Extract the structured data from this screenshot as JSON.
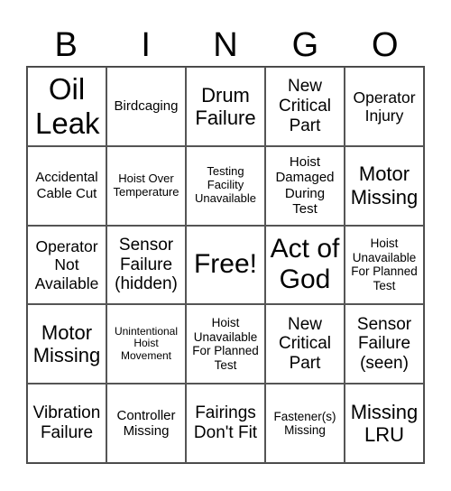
{
  "header": [
    "B",
    "I",
    "N",
    "G",
    "O"
  ],
  "cells": [
    [
      "Oil Leak",
      "Birdcaging",
      "Drum Failure",
      "New Critical Part",
      "Operator Injury"
    ],
    [
      "Accidental Cable Cut",
      "Hoist Over Temperature",
      "Testing Facility Unavailable",
      "Hoist Damaged During Test",
      "Motor Missing"
    ],
    [
      "Operator Not Available",
      "Sensor Failure (hidden)",
      "Free!",
      "Act of God",
      "Hoist Unavailable For Planned Test"
    ],
    [
      "Motor Missing",
      "Unintentional Hoist Movement",
      "Hoist Unavailable For Planned Test",
      "New Critical Part",
      "Sensor Failure (seen)"
    ],
    [
      "Vibration Failure",
      "Controller Missing",
      "Fairings Don't Fit",
      "Fastener(s) Missing",
      "Missing LRU"
    ]
  ]
}
